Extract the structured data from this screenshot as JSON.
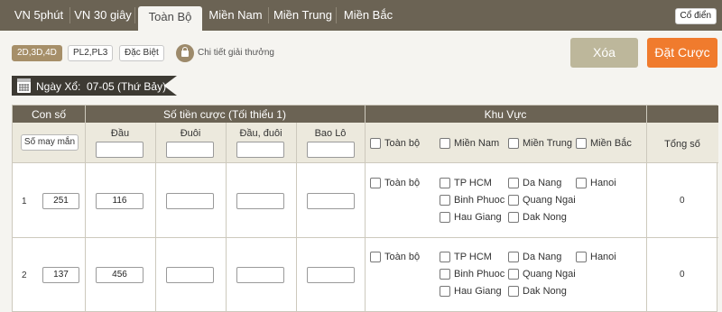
{
  "tabs": [
    {
      "label": "VN 5phút"
    },
    {
      "label": "VN 30 giây"
    },
    {
      "label": "Toàn Bộ",
      "active": true
    },
    {
      "label": "Miền Nam"
    },
    {
      "label": "Miền Trung"
    },
    {
      "label": "Miền Bắc"
    }
  ],
  "classic_label": "Cổ điển",
  "game_types": [
    {
      "label": "2D,3D,4D",
      "active": true
    },
    {
      "label": "PL2,PL3"
    },
    {
      "label": "Đặc Biệt"
    }
  ],
  "prize_link": "Chi tiết giải thưởng",
  "clear_button": "Xóa",
  "bet_button": "Đặt Cược",
  "draw": {
    "label": "Ngày Xổ:",
    "value": "07-05 (Thứ Bảy)"
  },
  "colors": {
    "header": "#6b6354",
    "accent": "#f07b2d",
    "active_chip": "#a68f69",
    "clear": "#bdb79b"
  },
  "table": {
    "headers": {
      "number": "Con số",
      "amount": "Số tiền cược (Tối thiểu 1)",
      "region": "Khu Vực",
      "total": "Tổng số"
    },
    "lucky_button": "Số may mắn",
    "amount_columns": [
      "Đầu",
      "Đuôi",
      "Đầu, đuôi",
      "Bao Lô"
    ],
    "region_filters": [
      "Toàn bộ",
      "Miền Nam",
      "Miền Trung",
      "Miền Bắc"
    ],
    "rows": [
      {
        "index": "1",
        "number": "251",
        "amounts": [
          "116",
          "",
          "",
          ""
        ],
        "all_label": "Toàn bộ",
        "regions": [
          "TP HCM",
          "Da Nang",
          "Hanoi",
          "Binh Phuoc",
          "Quang Ngai",
          "Hau Giang",
          "Dak Nong"
        ],
        "total": "0"
      },
      {
        "index": "2",
        "number": "137",
        "amounts": [
          "456",
          "",
          "",
          ""
        ],
        "all_label": "Toàn bộ",
        "regions": [
          "TP HCM",
          "Da Nang",
          "Hanoi",
          "Binh Phuoc",
          "Quang Ngai",
          "Hau Giang",
          "Dak Nong"
        ],
        "total": "0"
      }
    ]
  }
}
